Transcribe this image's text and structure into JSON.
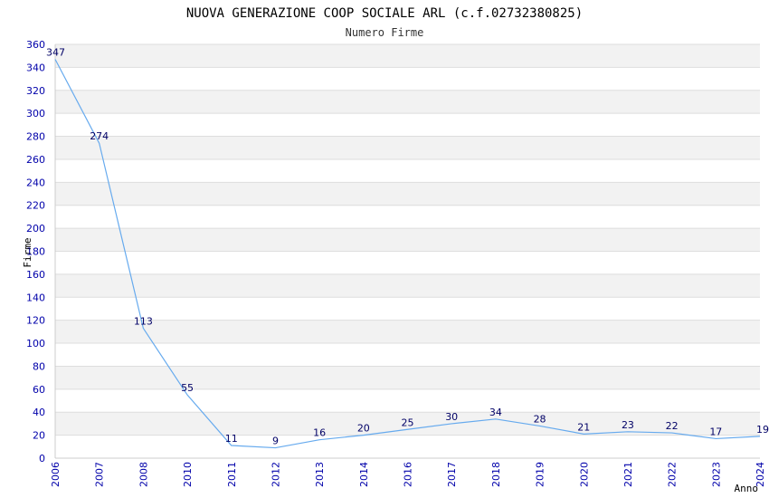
{
  "chart_data": {
    "type": "line",
    "title": "NUOVA GENERAZIONE COOP SOCIALE ARL (c.f.02732380825)",
    "subtitle": "Numero Firme",
    "xlabel": "Anno",
    "ylabel": "Firme",
    "categories": [
      "2006",
      "2007",
      "2008",
      "2010",
      "2011",
      "2012",
      "2013",
      "2014",
      "2016",
      "2017",
      "2018",
      "2019",
      "2020",
      "2021",
      "2022",
      "2023",
      "2024"
    ],
    "values": [
      347,
      274,
      113,
      55,
      11,
      9,
      16,
      20,
      25,
      30,
      34,
      28,
      21,
      23,
      22,
      17,
      19
    ],
    "ylim": [
      0,
      360
    ],
    "yticks": [
      0,
      20,
      40,
      60,
      80,
      100,
      120,
      140,
      160,
      180,
      200,
      220,
      240,
      260,
      280,
      300,
      320,
      340,
      360
    ],
    "grid": "horizontal bands",
    "line_color": "#66aaee",
    "band_color": "#f2f2f2",
    "tick_color": "#0000aa",
    "label_color": "#000066"
  }
}
